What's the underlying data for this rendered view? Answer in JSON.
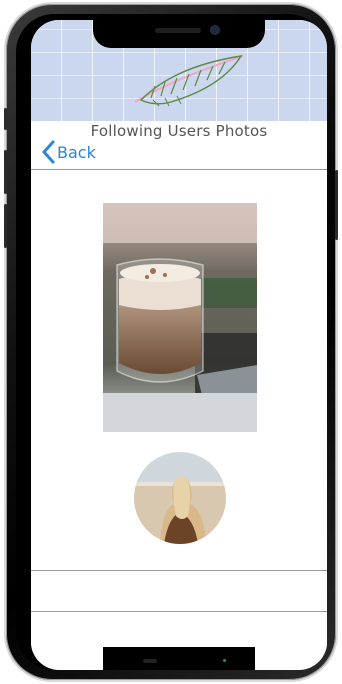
{
  "nav": {
    "title": "Following Users Photos",
    "back_label": "Back",
    "back_icon": "chevron-left-icon"
  },
  "colors": {
    "accent": "#2b86d6",
    "banner": "#cad7ef",
    "title_text": "#555555",
    "divider": "#9a9a9a"
  },
  "icons": {
    "banner_art": "feather-icon"
  },
  "content": {
    "photo": "latte-glass-photo",
    "avatar": "user-avatar-photo"
  }
}
